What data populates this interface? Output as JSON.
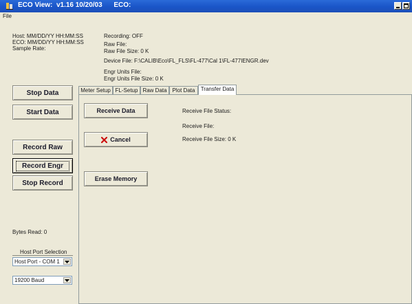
{
  "window": {
    "title": "ECO View:  v1.16 10/20/03      ECO:"
  },
  "menu": {
    "file": "File"
  },
  "status": {
    "host": "Host:  MM/DD/YY HH:MM:SS",
    "eco": "ECO:  MM/DD/YY HH:MM:SS",
    "sample_rate": "Sample Rate:",
    "recording": "Recording:  OFF",
    "raw_file": "Raw File:",
    "raw_file_size": "Raw File Size:  0 K",
    "device_file": "Device File:  F:\\CALIB\\Eco\\FL_FLS\\FL-477\\Cal 1\\FL-477IENGR.dev",
    "engr_units_file": "Engr Units File:",
    "engr_units_file_size": "Engr Units File Size:  0 K"
  },
  "left_buttons": {
    "stop_data": "Stop Data",
    "start_data": "Start Data",
    "record_raw": "Record  Raw",
    "record_engr": "Record Engr",
    "stop_record": "Stop Record"
  },
  "bytes_read": "Bytes Read:  0",
  "host_port": {
    "label": "Host Port Selection",
    "port": "Host Port - COM 1",
    "baud": "19200 Baud"
  },
  "tabs": [
    "Meter Setup",
    "FL-Setup",
    "Raw Data",
    "Plot Data",
    "Transfer Data"
  ],
  "transfer": {
    "receive_data": "Receive Data",
    "cancel": "Cancel",
    "erase_memory": "Erase Memory",
    "receive_file_status": "Receive File Status:",
    "receive_file": "Receive File:",
    "receive_file_size": "Receive File Size:  0 K"
  },
  "colors": {
    "title_bar": "#1a55c8",
    "window_bg": "#ece9d8",
    "cancel_icon": "#cc1010"
  }
}
